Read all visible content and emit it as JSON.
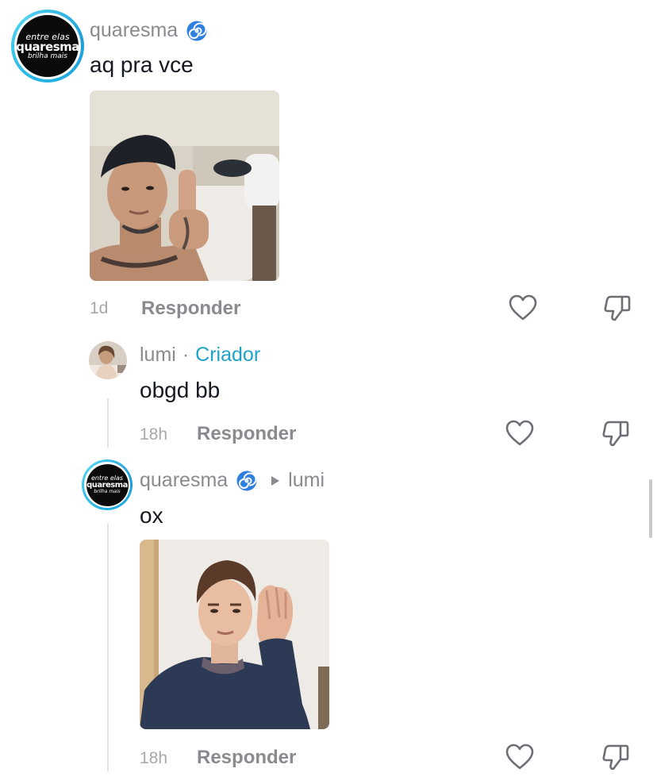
{
  "comments": [
    {
      "username": "quaresma",
      "badge_icon": "spiral-emoji-icon",
      "text": "aq pra vce",
      "time": "1d",
      "reply_label": "Responder",
      "avatar_logo": {
        "top": "entre elas",
        "mid": "quaresma",
        "bottom": "brilha mais"
      }
    },
    {
      "username": "lumi",
      "separator": "·",
      "creator_label": "Criador",
      "text": "obgd bb",
      "time": "18h",
      "reply_label": "Responder"
    },
    {
      "username": "quaresma",
      "badge_icon": "spiral-emoji-icon",
      "reply_to": "lumi",
      "text": "ox",
      "time": "18h",
      "reply_label": "Responder",
      "avatar_logo": {
        "top": "entre elas",
        "mid": "quaresma",
        "bottom": "brilha mais"
      }
    }
  ],
  "colors": {
    "creator": "#1ea2c9",
    "avatar_ring": "#27b6e6",
    "muted_text": "#8a8b91"
  },
  "icons": [
    "heart-outline-icon",
    "thumbs-down-icon",
    "play-triangle-icon",
    "spiral-emoji-icon"
  ]
}
